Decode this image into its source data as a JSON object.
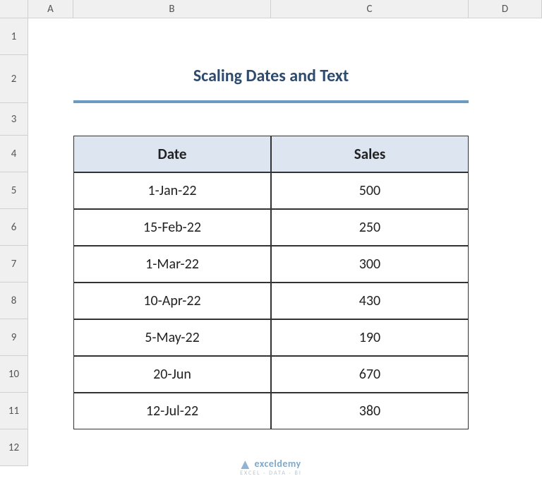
{
  "columns": [
    "A",
    "B",
    "C",
    "D"
  ],
  "row_numbers": [
    "1",
    "2",
    "3",
    "4",
    "5",
    "6",
    "7",
    "8",
    "9",
    "10",
    "11",
    "12"
  ],
  "title": "Scaling Dates and Text",
  "table": {
    "headers": {
      "date": "Date",
      "sales": "Sales"
    },
    "rows": [
      {
        "date": "1-Jan-22",
        "sales": "500"
      },
      {
        "date": "15-Feb-22",
        "sales": "250"
      },
      {
        "date": "1-Mar-22",
        "sales": "300"
      },
      {
        "date": "10-Apr-22",
        "sales": "430"
      },
      {
        "date": "5-May-22",
        "sales": "190"
      },
      {
        "date": "20-Jun",
        "sales": "670"
      },
      {
        "date": "12-Jul-22",
        "sales": "380"
      }
    ]
  },
  "watermark": {
    "brand": "exceldemy",
    "sub": "EXCEL · DATA · BI"
  }
}
